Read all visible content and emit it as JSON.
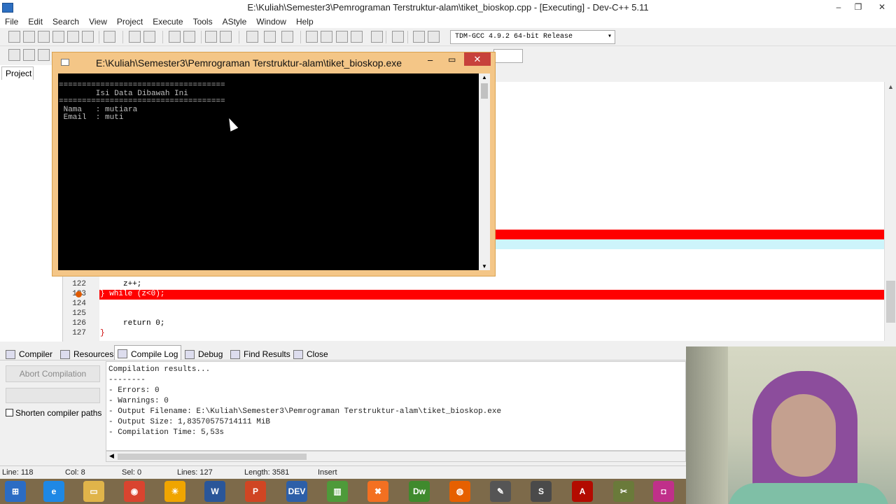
{
  "window": {
    "title": "E:\\Kuliah\\Semester3\\Pemrograman Terstruktur-alam\\tiket_bioskop.cpp - [Executing] - Dev-C++ 5.11",
    "minimize": "–",
    "maximize": "❐",
    "close": "✕"
  },
  "menu": [
    "File",
    "Edit",
    "Search",
    "View",
    "Project",
    "Execute",
    "Tools",
    "AStyle",
    "Window",
    "Help"
  ],
  "toolbar": {
    "compiler": "TDM-GCC 4.9.2 64-bit Release",
    "dropdown_arrow": "▾"
  },
  "left_panel": {
    "tab": "Project"
  },
  "editor": {
    "lines": [
      {
        "n": "122",
        "code": "     z++;"
      },
      {
        "n": "123",
        "code": "} while (z<0);"
      },
      {
        "n": "124",
        "code": ""
      },
      {
        "n": "125",
        "code": ""
      },
      {
        "n": "126",
        "code": "     return 0;"
      },
      {
        "n": "127",
        "code": "}"
      }
    ],
    "scroll_up": "▲"
  },
  "console": {
    "title": "E:\\Kuliah\\Semester3\\Pemrograman Terstruktur-alam\\tiket_bioskop.exe",
    "minimize": "–",
    "maximize": "▭",
    "close": "✕",
    "output": "====================================\n        Isi Data Dibawah Ini\n====================================\n Nama   : mutiara\n Email  : muti",
    "scroll_up": "▲",
    "scroll_down": "▼"
  },
  "bottom_tabs": [
    "Compiler",
    "Resources",
    "Compile Log",
    "Debug",
    "Find Results",
    "Close"
  ],
  "compile_panel": {
    "abort_button": "Abort Compilation",
    "shorten_label": "Shorten compiler paths",
    "log": "Compilation results...\n--------\n- Errors: 0\n- Warnings: 0\n- Output Filename: E:\\Kuliah\\Semester3\\Pemrograman Terstruktur-alam\\tiket_bioskop.exe\n- Output Size: 1,83570575714111 MiB\n- Compilation Time: 5,53s",
    "scroll_left": "◀"
  },
  "status": {
    "line": "Line:  118",
    "col": "Col:   8",
    "sel": "Sel:   0",
    "lines": "Lines:  127",
    "length": "Length:  3581",
    "mode": "Insert"
  },
  "taskbar": [
    {
      "name": "start",
      "label": "⊞",
      "color": "#2b6cc4"
    },
    {
      "name": "ie",
      "label": "e",
      "color": "#1e88e5"
    },
    {
      "name": "explorer",
      "label": "▭",
      "color": "#e0b44a"
    },
    {
      "name": "chrome",
      "label": "◉",
      "color": "#d9442f"
    },
    {
      "name": "weather",
      "label": "☀",
      "color": "#f0a500"
    },
    {
      "name": "word",
      "label": "W",
      "color": "#2a5699"
    },
    {
      "name": "powerpoint",
      "label": "P",
      "color": "#d04523"
    },
    {
      "name": "devcpp",
      "label": "DEV",
      "color": "#2d5fa8"
    },
    {
      "name": "chart",
      "label": "▥",
      "color": "#4e9a3a"
    },
    {
      "name": "xampp",
      "label": "✖",
      "color": "#f37021"
    },
    {
      "name": "dreamweaver",
      "label": "Dw",
      "color": "#3f8a2d"
    },
    {
      "name": "firefox",
      "label": "◍",
      "color": "#e66000"
    },
    {
      "name": "inkscape",
      "label": "✎",
      "color": "#555555"
    },
    {
      "name": "sublime",
      "label": "S",
      "color": "#4a4a4a"
    },
    {
      "name": "acrobat",
      "label": "A",
      "color": "#b30b00"
    },
    {
      "name": "paint",
      "label": "✂",
      "color": "#6a7a3a"
    },
    {
      "name": "camera",
      "label": "◘",
      "color": "#c0308a"
    }
  ]
}
